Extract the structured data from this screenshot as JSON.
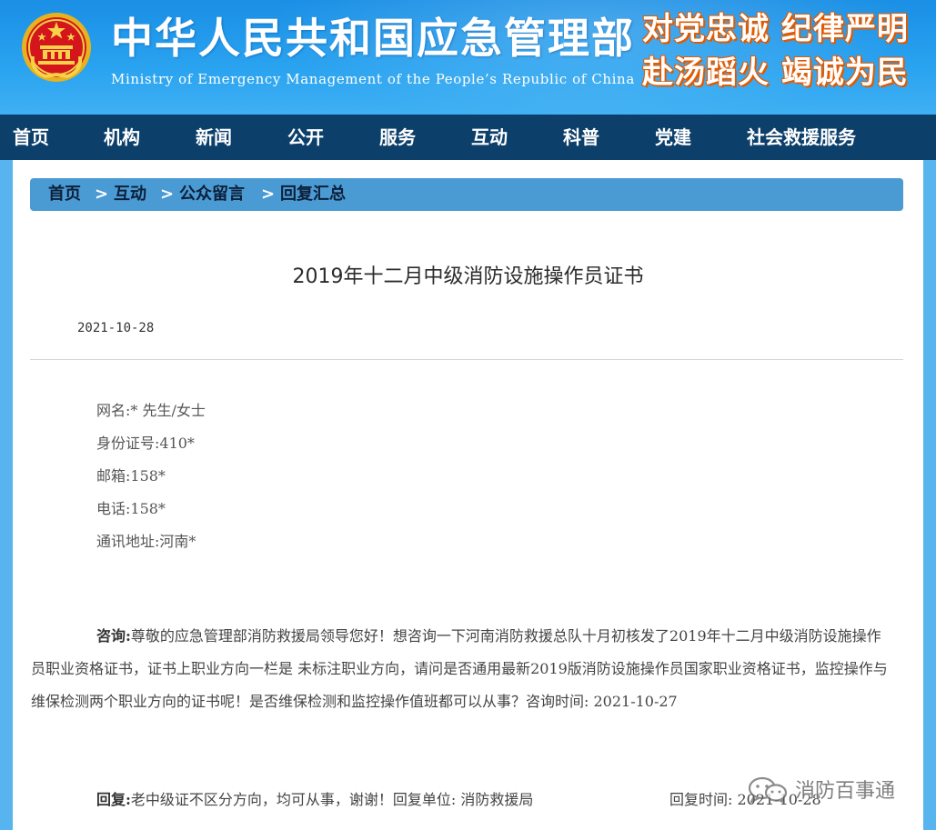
{
  "header": {
    "title": "中华人民共和国应急管理部",
    "subtitle": "Ministry of Emergency Management of the People’s Republic of China",
    "slogan_line1": "对党忠诚 纪律严明",
    "slogan_line2": "赴汤蹈火 竭诚为民",
    "emblem_icon": "national-emblem-icon"
  },
  "nav": {
    "items": [
      "首页",
      "机构",
      "新闻",
      "公开",
      "服务",
      "互动",
      "科普",
      "党建",
      "社会救援服务"
    ]
  },
  "breadcrumb": {
    "items": [
      "首页",
      "互动",
      "公众留言",
      "回复汇总"
    ],
    "separator": ">"
  },
  "article": {
    "title": "2019年十二月中级消防设施操作员证书",
    "date": "2021-10-28",
    "info": [
      "网名:* 先生/女士",
      "身份证号:410*",
      "邮箱:158*",
      "电话:158*",
      "通讯地址:河南*"
    ],
    "question_label": "咨询:",
    "question_text": "尊敬的应急管理部消防救援局领导您好！想咨询一下河南消防救援总队十月初核发了2019年十二月中级消防设施操作员职业资格证书，证书上职业方向一栏是 未标注职业方向，请问是否通用最新2019版消防设施操作员国家职业资格证书，监控操作与维保检测两个职业方向的证书呢！是否维保检测和监控操作值班都可以从事？咨询时间: 2021-10-27",
    "reply_label": "回复:",
    "reply_text": "老中级证不区分方向，均可从事，谢谢！回复单位: 消防救援局",
    "reply_time": "回复时间: 2021-10-28"
  },
  "watermark": {
    "text": "消防百事通",
    "icon": "wechat-icon"
  },
  "colors": {
    "header_blue": "#1a8fe5",
    "nav_dark": "#0d3f6b",
    "breadcrumb_blue": "#4a9bd3",
    "slogan_orange": "#e05a00",
    "page_bg": "#58b4ef"
  }
}
